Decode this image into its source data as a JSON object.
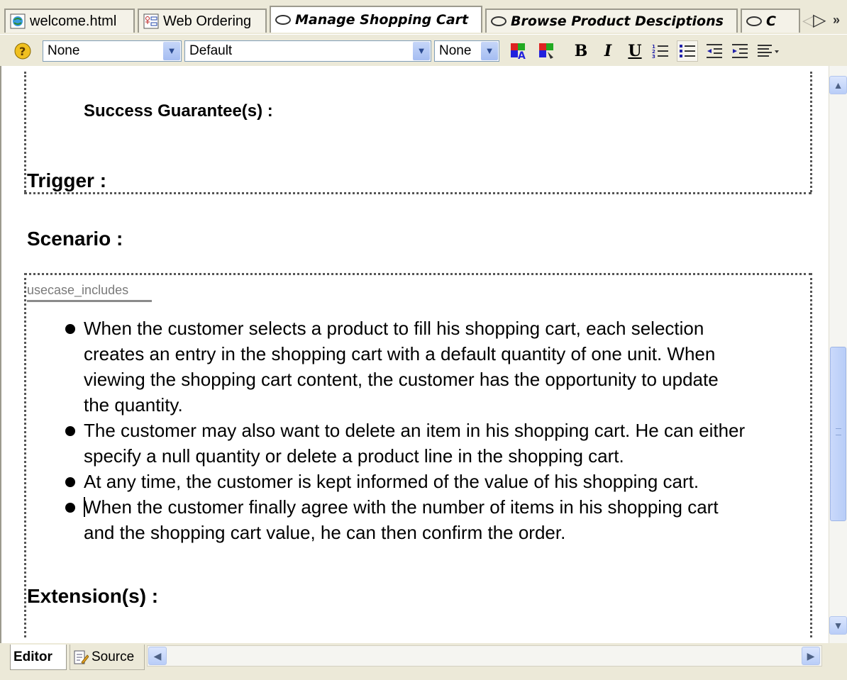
{
  "tabs": [
    {
      "label": "welcome.html",
      "icon": "html-page-icon"
    },
    {
      "label": "Web Ordering",
      "icon": "diagram-icon"
    },
    {
      "label": "Manage Shopping Cart",
      "icon": "usecase-oval-icon",
      "active": true
    },
    {
      "label": "Browse Product Desciptions",
      "icon": "usecase-oval-icon"
    },
    {
      "label": "C",
      "icon": "usecase-oval-icon"
    }
  ],
  "toolbar": {
    "paragraph_style": "None",
    "font": "Default",
    "size": "None",
    "bold": "B",
    "italic": "I",
    "underline": "U"
  },
  "document": {
    "success_guarantee": "Success Guarantee(s) :",
    "trigger": "Trigger :",
    "scenario": "Scenario :",
    "includes_label": "usecase_includes",
    "bullet_lines": [
      "When the customer selects a product to fill his shopping cart, each selection",
      "creates an entry in the shopping cart with a default quantity of one unit. When",
      "viewing the shopping cart content, the customer has the opportunity to update",
      "the quantity.",
      "The customer may also want to delete an item in his shopping cart. He can either",
      "specify a null quantity or delete a product line in the shopping cart.",
      "At any time, the customer is kept informed of the value of his shopping cart.",
      "When the customer finally agree with the number of items in his shopping cart",
      "and the shopping cart value, he can then confirm the order."
    ],
    "extensions": "Extension(s) :"
  },
  "bottom_tabs": {
    "editor": "Editor",
    "source": "Source"
  },
  "colors": {
    "window_bg": "#ece9d8",
    "scroll_blue": "#b9cdf8",
    "dotted_border": "#555555"
  }
}
